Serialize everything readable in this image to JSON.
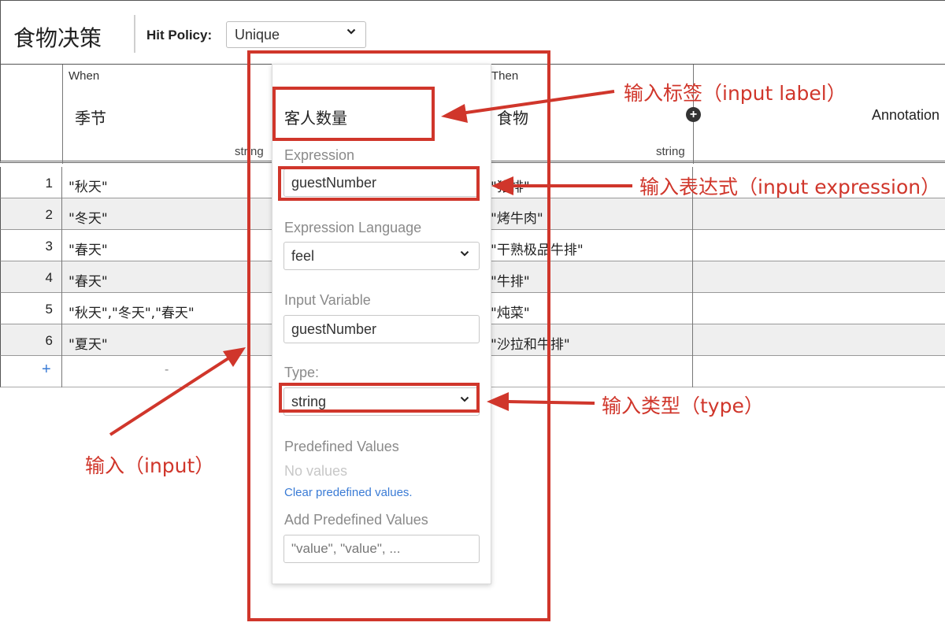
{
  "header": {
    "title": "食物决策",
    "hit_policy_label": "Hit Policy:",
    "hit_policy_value": "Unique"
  },
  "table": {
    "columns": [
      {
        "kind": "When",
        "label": "季节",
        "type": "string"
      },
      {
        "kind": "",
        "label": "",
        "type": "string"
      },
      {
        "kind": "Then",
        "label": "食物",
        "type": "string"
      },
      {
        "kind": "",
        "label": "Annotation",
        "type": ""
      }
    ],
    "rows": [
      {
        "num": "1",
        "when": "\"秋天\"",
        "then": "\"猪排\""
      },
      {
        "num": "2",
        "when": "\"冬天\"",
        "then": "\"烤牛肉\""
      },
      {
        "num": "3",
        "when": "\"春天\"",
        "then": "\"干熟极品牛排\""
      },
      {
        "num": "4",
        "when": "\"春天\"",
        "then": "\"牛排\""
      },
      {
        "num": "5",
        "when": "\"秋天\",\"冬天\",\"春天\"",
        "then": "\"炖菜\""
      },
      {
        "num": "6",
        "when": "\"夏天\"",
        "then": "\"沙拉和牛排\""
      }
    ],
    "add_row": {
      "plus": "+",
      "dash": "-"
    }
  },
  "panel": {
    "label_value": "客人数量",
    "expression_title": "Expression",
    "expression_value": "guestNumber",
    "expression_language_title": "Expression Language",
    "expression_language_value": "feel",
    "input_variable_title": "Input Variable",
    "input_variable_value": "guestNumber",
    "type_title": "Type:",
    "type_value": "string",
    "predefined_title": "Predefined Values",
    "no_values": "No values",
    "clear_link": "Clear predefined values.",
    "add_predefined_title": "Add Predefined Values",
    "add_predefined_placeholder": "\"value\", \"value\", ..."
  },
  "annotations": {
    "input_label": "输入标签（input label）",
    "input_expression": "输入表达式（input expression）",
    "input_type": "输入类型（type）",
    "input": "输入（input）"
  },
  "colors": {
    "annotation_red": "#d0362b",
    "link_blue": "#3a7bd5",
    "row_alt": "#efefef"
  }
}
